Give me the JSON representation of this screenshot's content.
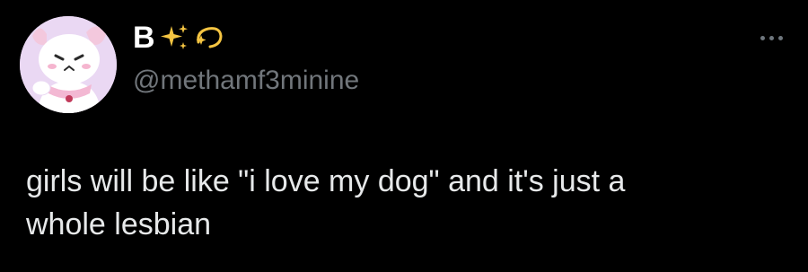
{
  "author": {
    "display_name": "B",
    "name_emojis": [
      "sparkles-icon",
      "dizzy-icon"
    ],
    "handle": "@methamf3minine",
    "avatar": "puppycat-avatar"
  },
  "tweet": {
    "text": "girls will be like \"i love my dog\" and it's just a\nwhole lesbian"
  },
  "actions": {
    "more_icon": "more-options-icon"
  },
  "colors": {
    "background": "#000000",
    "text": "#e7e9ea",
    "secondary": "#71767b",
    "sparkle": "#f5c542"
  }
}
